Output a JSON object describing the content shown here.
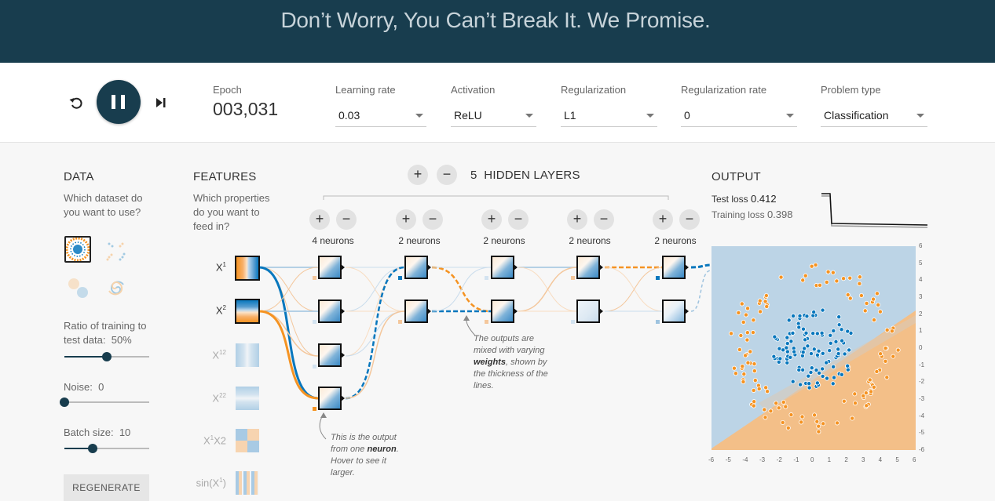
{
  "banner": {
    "title": "Don’t Worry, You Can’t Break It. We Promise."
  },
  "controls": {
    "reset": "reset-icon",
    "play": "pause-icon",
    "step": "step-icon"
  },
  "epoch": {
    "label": "Epoch",
    "value": "003,031"
  },
  "learning_rate": {
    "label": "Learning rate",
    "value": "0.03"
  },
  "activation": {
    "label": "Activation",
    "value": "ReLU"
  },
  "regularization": {
    "label": "Regularization",
    "value": "L1"
  },
  "regularization_rate": {
    "label": "Regularization rate",
    "value": "0"
  },
  "problem_type": {
    "label": "Problem type",
    "value": "Classification"
  },
  "data": {
    "title": "DATA",
    "question": "Which dataset do you want to use?",
    "ratio_label": "Ratio of training to test data:",
    "ratio_value": "50%",
    "ratio": 0.5,
    "noise_label": "Noise:",
    "noise_value": "0",
    "noise": 0,
    "batch_label": "Batch size:",
    "batch_value": "10",
    "batch": 0.33,
    "regenerate": "REGENERATE"
  },
  "features": {
    "title": "FEATURES",
    "question": "Which properties do you want to feed in?",
    "items": [
      {
        "base": "X",
        "sup": "1",
        "after": "",
        "active": true
      },
      {
        "base": "X",
        "sup": "2",
        "after": "",
        "active": true
      },
      {
        "base": "X",
        "sup": "12",
        "after": "",
        "active": false
      },
      {
        "base": "X",
        "sup": "22",
        "after": "",
        "active": false
      },
      {
        "base": "X",
        "sup": "1",
        "after": "X2",
        "active": false
      },
      {
        "base": "sin(X",
        "sup": "1",
        "after": ")",
        "active": false
      }
    ]
  },
  "hidden": {
    "count": "5",
    "label": "HIDDEN LAYERS",
    "layers": [
      "4 neurons",
      "2 neurons",
      "2 neurons",
      "2 neurons",
      "2 neurons"
    ]
  },
  "annotations": {
    "neuron_a": "This is the output from one ",
    "neuron_b": "neuron",
    "neuron_c": ". Hover to see it larger.",
    "mix_a": "The outputs are mixed with varying ",
    "mix_b": "weights",
    "mix_c": ", shown by the thickness of the lines."
  },
  "output": {
    "title": "OUTPUT",
    "test_loss_label": "Test loss",
    "test_loss": "0.412",
    "train_loss_label": "Training loss",
    "train_loss": "0.398",
    "ticks": [
      "-6",
      "-5",
      "-4",
      "-3",
      "-2",
      "-1",
      "0",
      "1",
      "2",
      "3",
      "4",
      "5",
      "6"
    ],
    "colors": {
      "positive": "#f59322",
      "negative": "#0877bd"
    }
  }
}
